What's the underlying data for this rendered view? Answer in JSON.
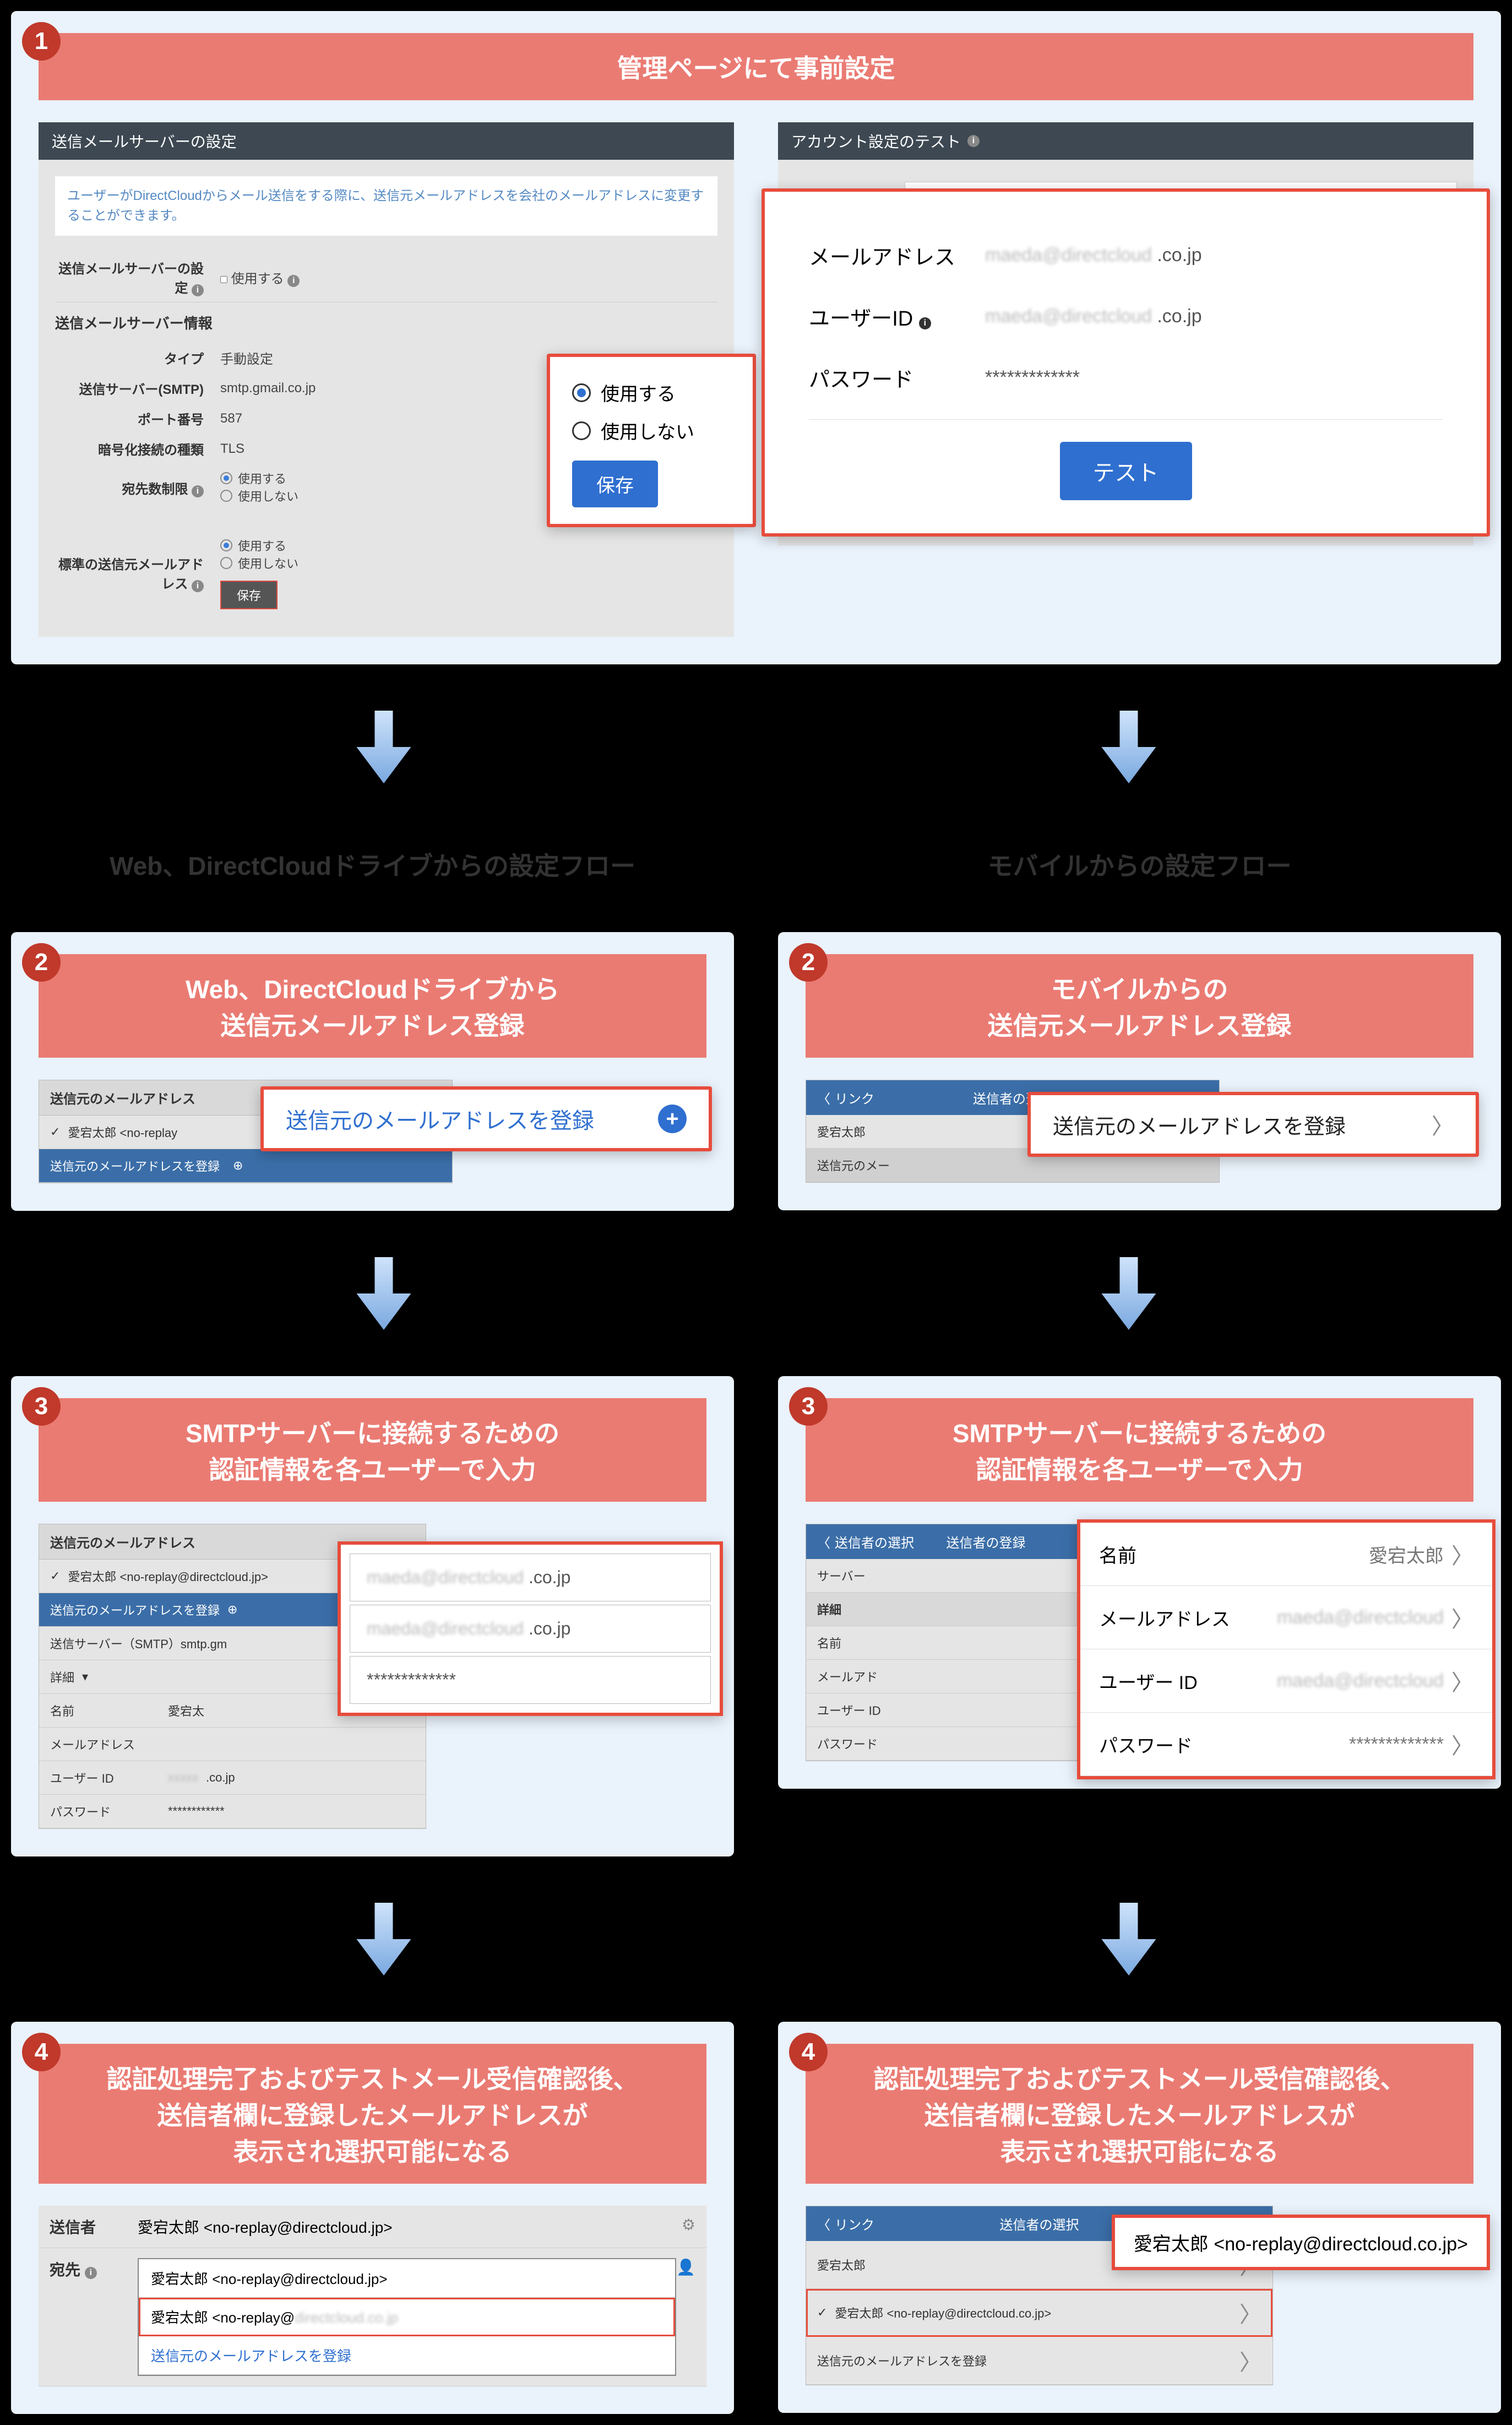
{
  "step1": {
    "title": "管理ページにて事前設定",
    "left": {
      "header": "送信メールサーバーの設定",
      "banner": "ユーザーがDirectCloudからメール送信をする際に、送信元メールアドレスを会社のメールアドレスに変更することができます。",
      "setting_label": "送信メールサーバーの設定",
      "setting_use": "使用する",
      "section_info": "送信メールサーバー情報",
      "rows": {
        "type_l": "タイプ",
        "type_v": "手動設定",
        "smtp_l": "送信サーバー(SMTP)",
        "smtp_v": "smtp.gmail.co.jp",
        "port_l": "ポート番号",
        "port_v": "587",
        "enc_l": "暗号化接続の種類",
        "enc_v": "TLS",
        "limit_l": "宛先数制限",
        "default_l": "標準の送信元メールアドレス"
      },
      "radio_use": "使用する",
      "radio_nouse": "使用しない",
      "mini_save": "保存",
      "zoom": {
        "use": "使用する",
        "nouse": "使用しない",
        "save": "保存"
      }
    },
    "right": {
      "header": "アカウント設定のテスト",
      "bg_rows": {
        "email_l": "メールアドレス",
        "userid_l": "ユーザーID"
      },
      "zoom": {
        "email_l": "メールアドレス",
        "email_suffix": ".co.jp",
        "userid_l": "ユーザーID",
        "userid_suffix": ".co.jp",
        "pw_l": "パスワード",
        "pw_v": "*************",
        "test": "テスト"
      }
    }
  },
  "branches": {
    "left_title": "Web、DirectCloudドライブからの設定フロー",
    "right_title": "モバイルからの設定フロー"
  },
  "step2": {
    "left_title_l1": "Web、DirectCloudドライブから",
    "left_title_l2": "送信元メールアドレス登録",
    "right_title_l1": "モバイルからの",
    "right_title_l2": "送信元メールアドレス登録",
    "left_bg": {
      "header": "送信元のメールアドレス",
      "item1": "愛宕太郎 <no-replay",
      "item2": "送信元のメールアドレスを登録"
    },
    "left_callout": "送信元のメールアドレスを登録",
    "right_bg": {
      "back": "リンク",
      "nav_title": "送信者の選択",
      "item1": "愛宕太郎",
      "item2": "送信元のメー"
    },
    "right_callout": "送信元のメールアドレスを登録"
  },
  "step3": {
    "title_l1": "SMTPサーバーに接続するための",
    "title_l2": "認証情報を各ユーザーで入力",
    "left_bg": {
      "header": "送信元のメールアドレス",
      "item_user": "愛宕太郎 <no-replay@directcloud.jp>",
      "item_reg": "送信元のメールアドレスを登録",
      "smtp": "送信サーバー（SMTP）smtp.gm",
      "detail": "詳細",
      "name_l": "名前",
      "name_v": "愛宕太",
      "mail_l": "メールアドレス",
      "uid_l": "ユーザー ID",
      "uid_suffix": ".co.jp",
      "pw_l": "パスワード"
    },
    "left_zoom": {
      "f1_suffix": ".co.jp",
      "f2_suffix": ".co.jp",
      "f3": "*************"
    },
    "right_bg": {
      "back": "送信者の選択",
      "nav_title": "送信者の登録",
      "srv_l": "サーバー",
      "detail_h": "詳細",
      "name_l": "名前",
      "mail_l": "メールアド",
      "uid_l": "ユーザー ID",
      "pw_l": "パスワード"
    },
    "right_zoom": {
      "name_l": "名前",
      "name_v": "愛宕太郎",
      "mail_l": "メールアドレス",
      "uid_l": "ユーザー ID",
      "pw_l": "パスワード",
      "pw_v": "*************"
    }
  },
  "step4": {
    "title_l1": "認証処理完了およびテストメール受信確認後、",
    "title_l2": "送信者欄に登録したメールアドレスが",
    "title_l3": "表示され選択可能になる",
    "left": {
      "sender_l": "送信者",
      "sender_v": "愛宕太郎 <no-replay@directcloud.jp>",
      "to_l": "宛先",
      "dd1": "愛宕太郎 <no-replay@directcloud.jp>",
      "dd2_pre": "愛宕太郎 <no-replay@",
      "dd3": "送信元のメールアドレスを登録"
    },
    "right": {
      "back": "リンク",
      "nav_title": "送信者の選択",
      "item1": "愛宕太郎",
      "item2": "愛宕太郎 <no-replay@directcloud.co.jp>",
      "item3": "送信元のメールアドレスを登録",
      "callout": "愛宕太郎 <no-replay@directcloud.co.jp>"
    }
  }
}
